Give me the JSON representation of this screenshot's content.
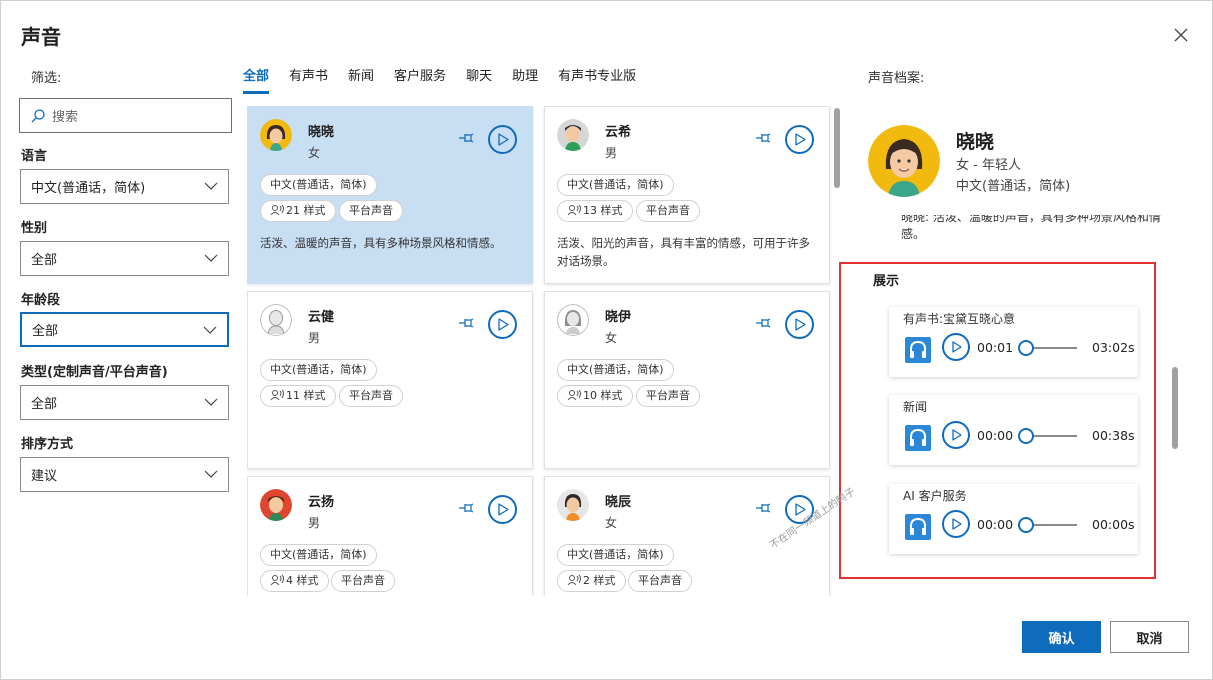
{
  "dialog": {
    "title": "声音"
  },
  "filters": {
    "label": "筛选:",
    "search_placeholder": "搜索",
    "language": {
      "label": "语言",
      "value": "中文(普通话，简体)"
    },
    "gender": {
      "label": "性别",
      "value": "全部"
    },
    "age": {
      "label": "年龄段",
      "value": "全部"
    },
    "type": {
      "label": "类型(定制声音/平台声音)",
      "value": "全部"
    },
    "sort": {
      "label": "排序方式",
      "value": "建议"
    }
  },
  "tabs": [
    {
      "label": "全部",
      "active": true
    },
    {
      "label": "有声书"
    },
    {
      "label": "新闻"
    },
    {
      "label": "客户服务"
    },
    {
      "label": "聊天"
    },
    {
      "label": "助理"
    },
    {
      "label": "有声书专业版"
    }
  ],
  "voices": [
    {
      "name": "晓晓",
      "gender": "女",
      "lang": "中文(普通话，简体)",
      "styles": "21 样式",
      "source": "平台声音",
      "desc": "活泼、温暖的声音，具有多种场景风格和情感。",
      "selected": true,
      "avatar": "female-yellow-avatar"
    },
    {
      "name": "云希",
      "gender": "男",
      "lang": "中文(普通话，简体)",
      "styles": "13 样式",
      "source": "平台声音",
      "desc": "活泼、阳光的声音，具有丰富的情感，可用于许多对话场景。",
      "avatar": "male-green-avatar"
    },
    {
      "name": "云健",
      "gender": "男",
      "lang": "中文(普通话，简体)",
      "styles": "11 样式",
      "source": "平台声音",
      "desc": "",
      "avatar": "male-gray-avatar"
    },
    {
      "name": "晓伊",
      "gender": "女",
      "lang": "中文(普通话，简体)",
      "styles": "10 样式",
      "source": "平台声音",
      "desc": "",
      "avatar": "female-gray-avatar"
    },
    {
      "name": "云扬",
      "gender": "男",
      "lang": "中文(普通话，简体)",
      "styles": "4 样式",
      "source": "平台声音",
      "desc": "",
      "avatar": "male-red-avatar"
    },
    {
      "name": "晓辰",
      "gender": "女",
      "lang": "中文(普通话，简体)",
      "styles": "2 样式",
      "source": "平台声音",
      "desc": "",
      "avatar": "female-orange-avatar"
    }
  ],
  "profile": {
    "label": "声音档案:",
    "name": "晓晓",
    "sub": "女 - 年轻人",
    "lang": "中文(普通话，简体)",
    "desc": "晓晓: 活泼、温暖的声音，具有多种场景风格和情感。",
    "showcase_title": "展示",
    "samples": [
      {
        "title": "有声书:宝黛互晓心意",
        "time": "00:01",
        "duration": "03:02s"
      },
      {
        "title": "新闻",
        "time": "00:00",
        "duration": "00:38s"
      },
      {
        "title": "AI 客户服务",
        "time": "00:00",
        "duration": "00:00s"
      }
    ]
  },
  "watermark": "不在同一频道上的鸭子",
  "buttons": {
    "confirm": "确认",
    "cancel": "取消"
  },
  "colors": {
    "accent": "#0f6cbd",
    "selected_card": "#c7def3",
    "highlight_box": "#e03131"
  }
}
